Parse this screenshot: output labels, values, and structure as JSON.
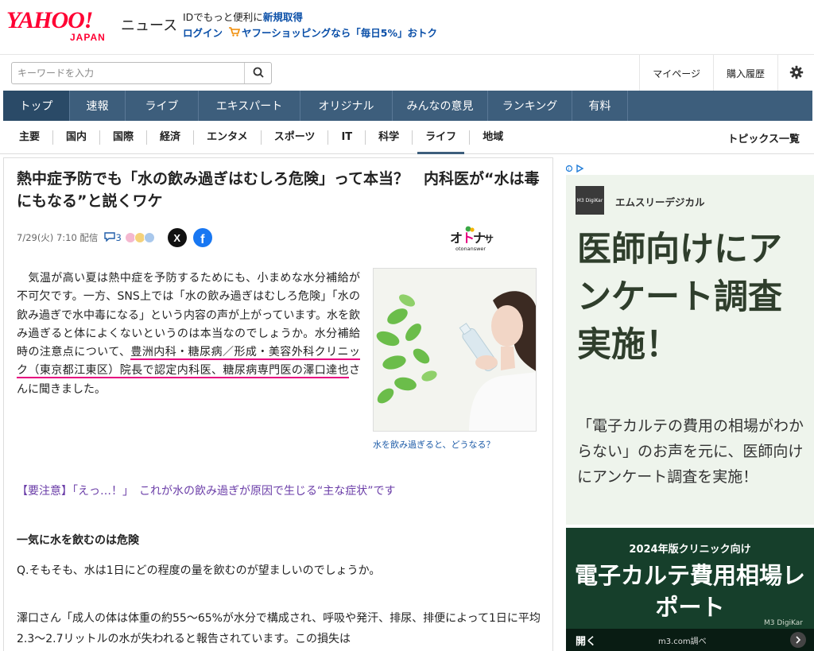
{
  "header": {
    "logo_main": "YAHOO!",
    "logo_sub": "JAPAN",
    "logo_service": "ニュース",
    "promo_prefix": "IDでもっと便利に",
    "promo_link": "新規取得",
    "login": "ログイン",
    "shopping_promo": "ヤフーショッピングなら「毎日5%」おトク"
  },
  "search": {
    "placeholder": "キーワードを入力",
    "mypage": "マイページ",
    "history": "購入履歴"
  },
  "main_nav": [
    {
      "label": "トップ",
      "active": true
    },
    {
      "label": "速報"
    },
    {
      "label": "ライブ"
    },
    {
      "label": "エキスパート"
    },
    {
      "label": "オリジナル"
    },
    {
      "label": "みんなの意見"
    },
    {
      "label": "ランキング"
    },
    {
      "label": "有料"
    }
  ],
  "sub_nav": [
    {
      "label": "主要"
    },
    {
      "label": "国内"
    },
    {
      "label": "国際"
    },
    {
      "label": "経済"
    },
    {
      "label": "エンタメ"
    },
    {
      "label": "スポーツ"
    },
    {
      "label": "IT"
    },
    {
      "label": "科学"
    },
    {
      "label": "ライフ",
      "active": true
    },
    {
      "label": "地域"
    }
  ],
  "topics_link": "トピックス一覧",
  "article": {
    "title": "熱中症予防でも「水の飲み過ぎはむしろ危険」って本当？　内科医が“水は毒にもなる”と説くワケ",
    "date": "7/29(火) 7:10 配信",
    "comment_count": "3",
    "source_name": "オトナンサー answer",
    "body_before": "　気温が高い夏は熱中症を予防するためにも、小まめな水分補給が不可欠です。一方、SNS上では「水の飲み過ぎはむしろ危険」「水の飲み過ぎで水中毒になる」という内容の声が上がっています。水を飲み過ぎると体によくないというのは本当なのでしょうか。水分補給時の注意点について、",
    "body_highlight": "豊洲内科・糖尿病／形成・美容外科クリニック（東京都江東区）院長で認定内科医、糖尿病専門医の澤口達也",
    "body_after": "さんに聞きました。",
    "caption": "水を飲み過ぎると、どうなる？",
    "related": "【要注意】「えっ…！」　これが水の飲み過ぎが原因で生じる“主な症状”です",
    "heading": "一気に水を飲むのは危険",
    "question": "Q.そもそも、水は1日にどの程度の量を飲むのが望ましいのでしょうか。",
    "answer": "澤口さん「成人の体は体重の約55～65%が水分で構成され、呼吸や発汗、排尿、排便によって1日に平均2.3～2.7リットルの水が失われると報告されています。この損失は"
  },
  "ad": {
    "brand": "エムスリーデジカル",
    "logo_text": "M3 DigiKar",
    "headline": "医師向けにアンケート調査実施！",
    "sub": "「電子カルテの費用の相場がわからない」のお声を元に、医師向けにアンケート調査を実施！",
    "bottom_small": "2024年版クリニック向け",
    "bottom_big": "電子カルテ費用相場レポート",
    "cta": "開く",
    "url": "m3.com調べ",
    "mark": "M3 DigiKar"
  }
}
